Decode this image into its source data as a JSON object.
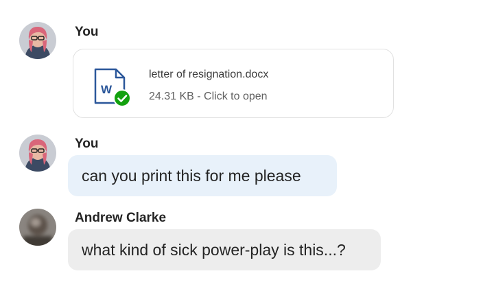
{
  "messages": [
    {
      "sender": "You",
      "avatar": "user-avatar",
      "attachment": {
        "icon": "word-document-icon",
        "status_icon": "checkmark-icon",
        "file_name": "letter of resignation.docx",
        "meta": "24.31 KB - Click to open",
        "colors": {
          "word_blue": "#2b579a",
          "check_green": "#13a10e"
        }
      }
    },
    {
      "sender": "You",
      "avatar": "user-avatar",
      "text": "can you print this for me please",
      "bubble_color": "#e8f1fa"
    },
    {
      "sender": "Andrew Clarke",
      "avatar": "blurred-avatar",
      "text": "what kind of sick power-play is this...?",
      "bubble_color": "#ededed"
    }
  ]
}
